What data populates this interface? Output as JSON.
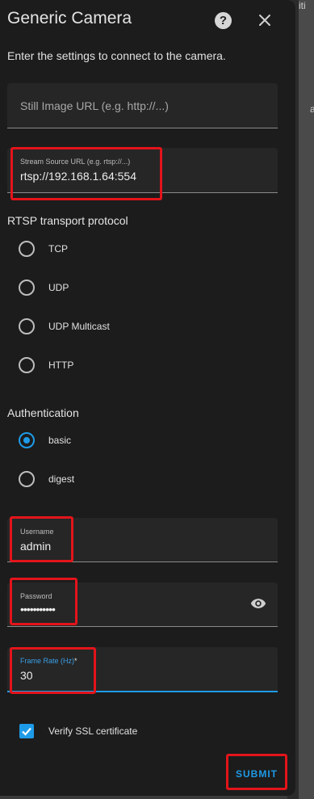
{
  "dialog": {
    "title": "Generic Camera",
    "description": "Enter the settings to connect to the camera.",
    "help_label": "?",
    "close_label": "×"
  },
  "still_image": {
    "placeholder": "Still Image URL (e.g. http://...)"
  },
  "stream_source": {
    "label": "Stream Source URL (e.g. rtsp://...)",
    "value": "rtsp://192.168.1.64:554"
  },
  "rtsp": {
    "heading": "RTSP transport protocol",
    "options": [
      "TCP",
      "UDP",
      "UDP Multicast",
      "HTTP"
    ],
    "selected": null
  },
  "authentication": {
    "heading": "Authentication",
    "options": [
      "basic",
      "digest"
    ],
    "selected": "basic"
  },
  "username": {
    "label": "Username",
    "value": "admin"
  },
  "password": {
    "label": "Password",
    "value": "•••••••••••"
  },
  "frame_rate": {
    "label": "Frame Rate (Hz)",
    "required_mark": "*",
    "value": "30"
  },
  "verify_ssl": {
    "label": "Verify SSL certificate",
    "checked": true
  },
  "actions": {
    "submit_label": "SUBMIT"
  },
  "background": {
    "fragment_top": "iti",
    "fragment_mid": "a"
  },
  "colors": {
    "accent": "#1e9be8",
    "highlight": "#e3141a",
    "dialog_bg": "#1c1c1c",
    "field_bg": "#262626"
  }
}
